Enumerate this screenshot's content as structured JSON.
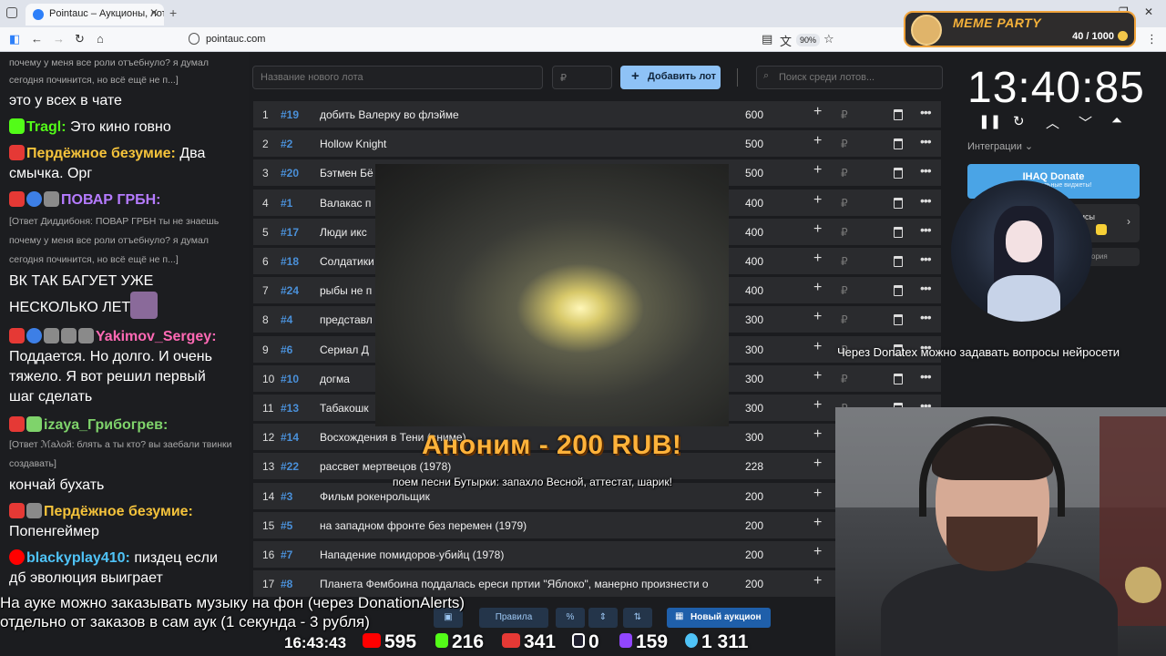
{
  "browser": {
    "tab_title": "Pointauc – Аукционы, лотереи",
    "tab_close": "✕",
    "new_tab": "+",
    "url": "pointauc.com",
    "zoom": "90%",
    "win_minimize": "—",
    "win_restore": "❐",
    "win_close": "✕",
    "menu": "⋮"
  },
  "meme_party": {
    "title": "MEME PARTY",
    "count": "40 / 1000"
  },
  "chat": {
    "messages": [
      {
        "reply": "почему у меня все роли отъебнуло? я думал",
        "reply2": "сегодня починится, но всё ещё не п...]"
      },
      {
        "text": "это у всех в чате"
      },
      {
        "name": "Tragl:",
        "text": "Это кино говно",
        "color": "#53fc18"
      },
      {
        "name": "Пердёжное безумие:",
        "text": "Два",
        "text2": "смычка. Орг",
        "color": "#f5c33b"
      },
      {
        "name": "ПОВАР ГРБН:",
        "color": "#b57bff"
      },
      {
        "reply": "[Ответ Диддибоня: ПОВАР ГРБН ты не знаешь",
        "reply2": "почему у меня все роли отъебнуло? я думал",
        "reply3": "сегодня починится, но всё ещё не п...]"
      },
      {
        "text": "ВК ТАК БАГУЕТ УЖЕ",
        "text2": "НЕСКОЛЬКО ЛЕТ"
      },
      {
        "name": "Yakimov_Sergey:",
        "text": "Поддается. Но долго. И очень",
        "text2": "тяжело. Я вот решил первый",
        "text3": "шаг сделать",
        "color": "#ff69b4"
      },
      {
        "name": "izaya_Грибогрев:",
        "color": "#7fd36b"
      },
      {
        "reply": "[Ответ ℳаλой: блять а ты кто? вы заебали твинки",
        "reply2": "создавать]"
      },
      {
        "text": "кончай бухать"
      },
      {
        "name": "Пердёжное безумие:",
        "text": "Попенгеймер",
        "color": "#f5c33b"
      },
      {
        "name": "blackyplay410:",
        "text": "пиздец если",
        "text2": "дб эволюция выиграет",
        "color": "#4fc3f7"
      }
    ]
  },
  "auction": {
    "new_lot_placeholder": "Название нового лота",
    "amount_placeholder": "₽",
    "add_button": "Добавить лот",
    "search_placeholder": "Поиск среди лотов...",
    "currency": "₽",
    "rows": [
      {
        "idx": "1",
        "num": "#19",
        "title": "добить Валерку во флэйме",
        "amount": "600"
      },
      {
        "idx": "2",
        "num": "#2",
        "title": "Hollow Knight",
        "amount": "500"
      },
      {
        "idx": "3",
        "num": "#20",
        "title": "Бэтмен Бё",
        "amount": "500"
      },
      {
        "idx": "4",
        "num": "#1",
        "title": "Валакас п",
        "amount": "400"
      },
      {
        "idx": "5",
        "num": "#17",
        "title": "Люди икс",
        "amount": "400"
      },
      {
        "idx": "6",
        "num": "#18",
        "title": "Солдатики",
        "amount": "400"
      },
      {
        "idx": "7",
        "num": "#24",
        "title": "рыбы не п",
        "amount": "400"
      },
      {
        "idx": "8",
        "num": "#4",
        "title": "представл",
        "amount": "300"
      },
      {
        "idx": "9",
        "num": "#6",
        "title": "Сериал Д",
        "amount": "300"
      },
      {
        "idx": "10",
        "num": "#10",
        "title": "догма",
        "amount": "300"
      },
      {
        "idx": "11",
        "num": "#13",
        "title": "Табакошк",
        "amount": "300"
      },
      {
        "idx": "12",
        "num": "#14",
        "title": "Восхождения в Тени (аниме)",
        "amount": "300"
      },
      {
        "idx": "13",
        "num": "#22",
        "title": "рассвет мертвецов (1978)",
        "amount": "228"
      },
      {
        "idx": "14",
        "num": "#3",
        "title": "Фильм рокенрольщик",
        "amount": "200"
      },
      {
        "idx": "15",
        "num": "#5",
        "title": "на западном фронте без перемен (1979)",
        "amount": "200"
      },
      {
        "idx": "16",
        "num": "#7",
        "title": "Нападение помидоров-убийц (1978)",
        "amount": "200"
      },
      {
        "idx": "17",
        "num": "#8",
        "title": "Планета Фембоина поддалась ереси пртии \"Яблоко\", манерно произнести о",
        "amount": "200"
      }
    ]
  },
  "toolbar": {
    "rules": "Правила",
    "percent": "%",
    "new_auction": "Новый аукцион"
  },
  "donation": {
    "headline": "Аноним - 200 RUB!",
    "message": "поем песни Бутырки: запахло Весной, аттестат, шарик!"
  },
  "timer": {
    "value": "13:40:85"
  },
  "integrations": {
    "label": "Интеграции ⌄",
    "iqbutton": "IHAQ Donate",
    "iqsub": "к.... уникальные виджеты!",
    "card2": "исы",
    "card3": "ория"
  },
  "overlay": {
    "note": "Через Donatex можно задавать вопросы нейросети",
    "ticker1": "На ауке можно заказывать музыку на фон (через DonationAlerts)",
    "ticker2": "отдельно от заказов в сам аук (1 секунда - 3 рубля)"
  },
  "stats": {
    "time": "16:43:43",
    "youtube": "595",
    "kick": "216",
    "vk": "341",
    "rutube": "0",
    "twitch": "159",
    "total": "1 311"
  },
  "colors": {
    "accent": "#4a90d9",
    "add_button": "#8ec2f6",
    "donate_text": "#ffb23a"
  }
}
